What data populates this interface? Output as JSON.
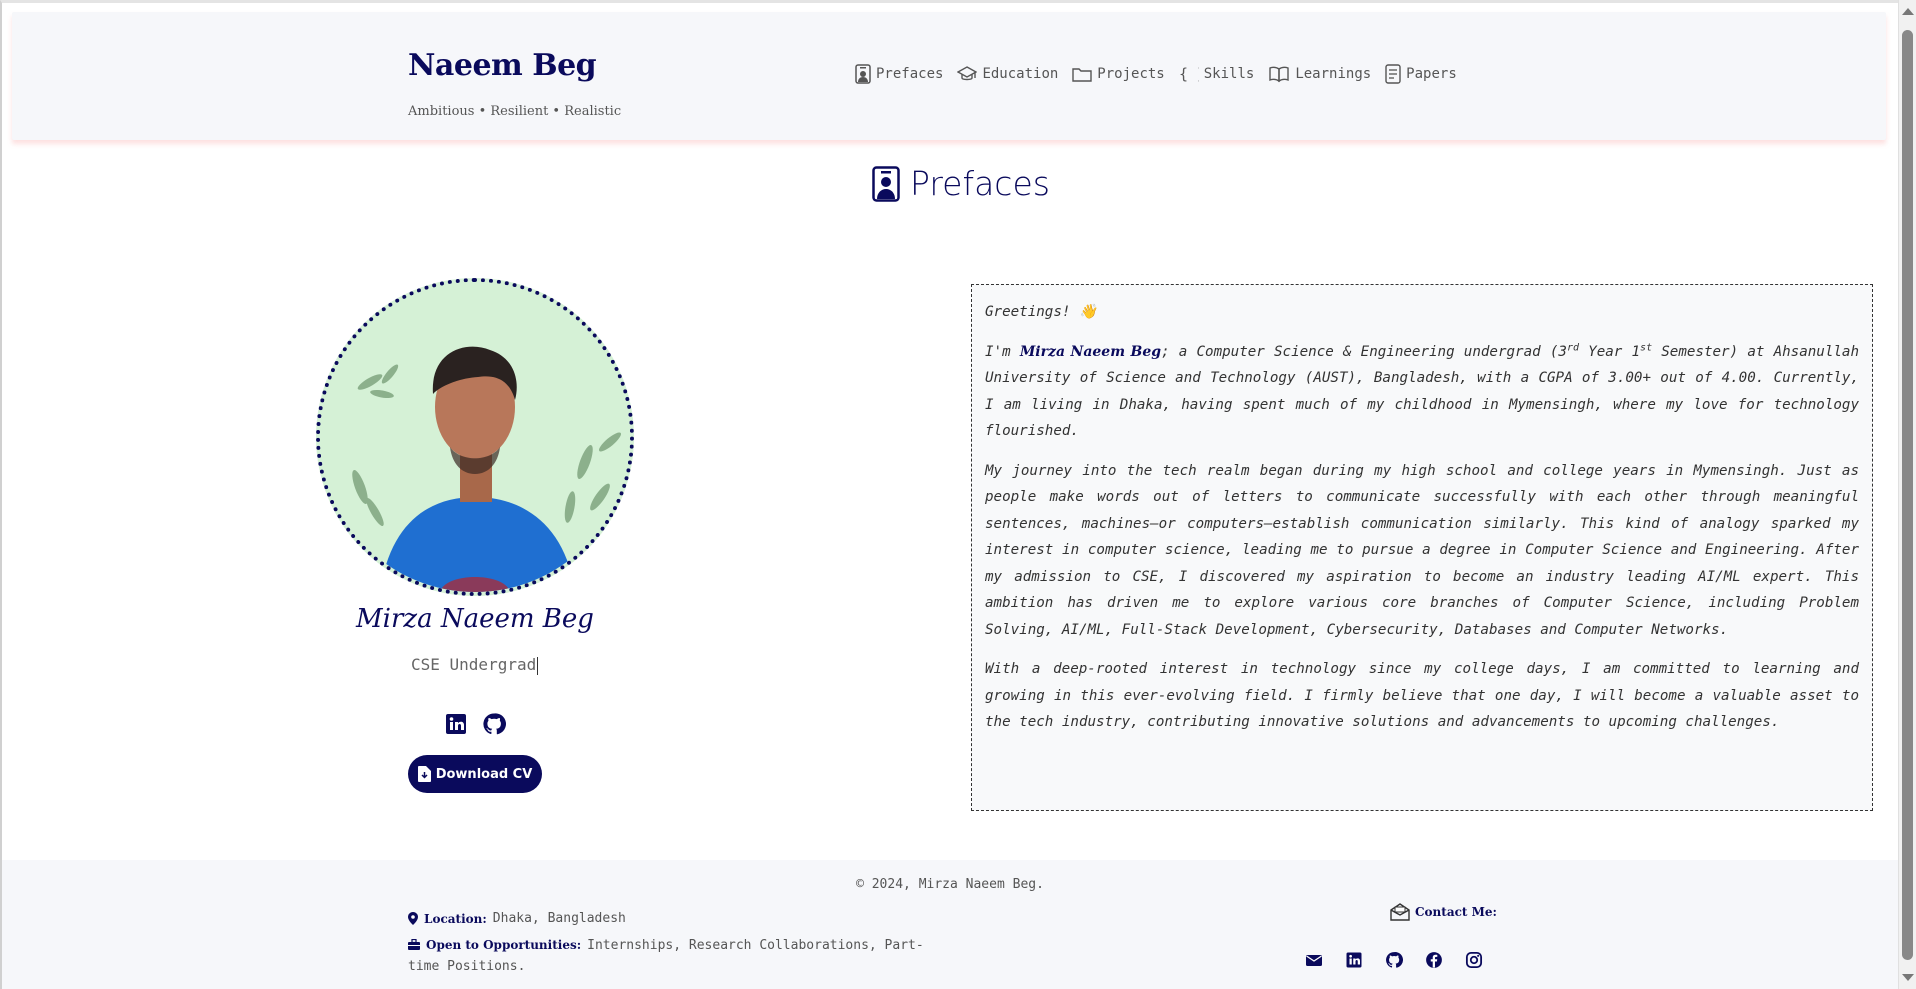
{
  "header": {
    "brand_name": "Naeem Beg",
    "tagline": "Ambitious • Resilient • Realistic",
    "nav": [
      {
        "label": "Prefaces",
        "icon": "person-badge-icon"
      },
      {
        "label": "Education",
        "icon": "graduation-cap-icon"
      },
      {
        "label": "Projects",
        "icon": "folder-icon"
      },
      {
        "label": "Skills",
        "icon": "braces-icon"
      },
      {
        "label": "Learnings",
        "icon": "book-icon"
      },
      {
        "label": "Papers",
        "icon": "document-icon"
      }
    ]
  },
  "section": {
    "title": "Prefaces",
    "icon": "person-badge-icon"
  },
  "profile": {
    "name": "Mirza Naeem Beg",
    "role": "CSE Undergrad",
    "social": [
      "linkedin-icon",
      "github-icon"
    ],
    "cv_button": "Download CV"
  },
  "intro": {
    "greeting": "Greetings! 👋",
    "p1_prefix": "I'm ",
    "p1_name": "Mirza Naeem Beg",
    "p1_a": "; a Computer Science & Engineering undergrad (3",
    "p1_sup1": "rd",
    "p1_b": " Year 1",
    "p1_sup2": "st",
    "p1_c": " Semester) at Ahsanullah University of Science and Technology (AUST), Bangladesh, with a CGPA of 3.00+ out of 4.00. Currently, I am living in Dhaka, having spent much of my childhood in Mymensingh, where my love for technology flourished.",
    "p2": "My journey into the tech realm began during my high school and college years in Mymensingh. Just as people make words out of letters to communicate successfully with each other through meaningful sentences, machines—or computers—establish communication similarly. This kind of analogy sparked my interest in computer science, leading me to pursue a degree in Computer Science and Engineering. After my admission to CSE, I discovered my aspiration to become an industry leading AI/ML expert. This ambition has driven me to explore various core branches of Computer Science, including Problem Solving, AI/ML, Full-Stack Development, Cybersecurity, Databases and Computer Networks.",
    "p3": "With a deep-rooted interest in technology since my college days, I am committed to learning and growing in this ever-evolving field. I firmly believe that one day, I will become a valuable asset to the tech industry, contributing innovative solutions and advancements to upcoming challenges."
  },
  "footer": {
    "copyright": "© 2024, Mirza Naeem Beg.",
    "location_label": "Location:",
    "location_value": "Dhaka, Bangladesh",
    "opportunities_label": "Open to Opportunities:",
    "opportunities_value": "Internships, Research Collaborations, Part-time Positions.",
    "contact_label": "Contact Me:",
    "contact_icons": [
      "email-icon",
      "linkedin-icon",
      "github-icon",
      "facebook-icon",
      "instagram-icon"
    ]
  },
  "colors": {
    "accent": "#0a0a5c",
    "header_bg": "#f6f7fa",
    "avatar_bg": "#d5f1d6"
  }
}
